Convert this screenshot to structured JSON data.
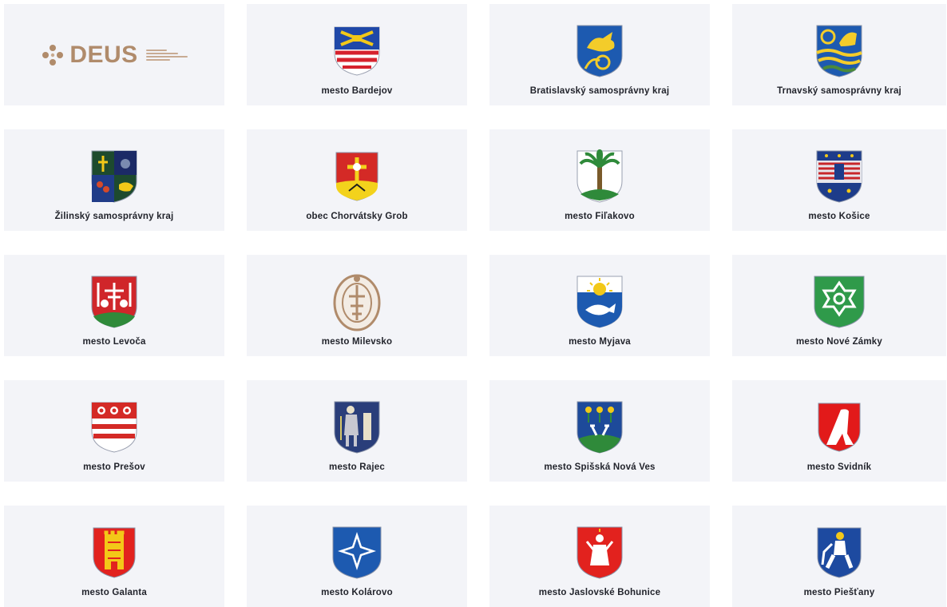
{
  "logo": {
    "wordmark": "DEUS",
    "color": "#b08b6b"
  },
  "cards": [
    {
      "label": "mesto Bardejov",
      "icon": "bardejov-crest-icon"
    },
    {
      "label": "Bratislavský samosprávny kraj",
      "icon": "bratislava-region-crest-icon"
    },
    {
      "label": "Trnavský samosprávny kraj",
      "icon": "trnava-region-crest-icon"
    },
    {
      "label": "Žilinský samosprávny kraj",
      "icon": "zilina-region-crest-icon"
    },
    {
      "label": "obec Chorvátsky Grob",
      "icon": "chorvatsky-grob-crest-icon"
    },
    {
      "label": "mesto Fiľakovo",
      "icon": "filakovo-crest-icon"
    },
    {
      "label": "mesto Košice",
      "icon": "kosice-crest-icon"
    },
    {
      "label": "mesto Levoča",
      "icon": "levoca-crest-icon"
    },
    {
      "label": "mesto Milevsko",
      "icon": "milevsko-crest-icon"
    },
    {
      "label": "mesto Myjava",
      "icon": "myjava-crest-icon"
    },
    {
      "label": "mesto Nové Zámky",
      "icon": "nove-zamky-crest-icon"
    },
    {
      "label": "mesto Prešov",
      "icon": "presov-crest-icon"
    },
    {
      "label": "mesto Rajec",
      "icon": "rajec-crest-icon"
    },
    {
      "label": "mesto Spišská Nová Ves",
      "icon": "spisska-nova-ves-crest-icon"
    },
    {
      "label": "mesto Svidník",
      "icon": "svidnik-crest-icon"
    },
    {
      "label": "mesto Galanta",
      "icon": "galanta-crest-icon"
    },
    {
      "label": "mesto Kolárovo",
      "icon": "kolarovo-crest-icon"
    },
    {
      "label": "mesto Jaslovské Bohunice",
      "icon": "jaslovske-bohunice-crest-icon"
    },
    {
      "label": "mesto Piešťany",
      "icon": "piestany-crest-icon"
    }
  ]
}
